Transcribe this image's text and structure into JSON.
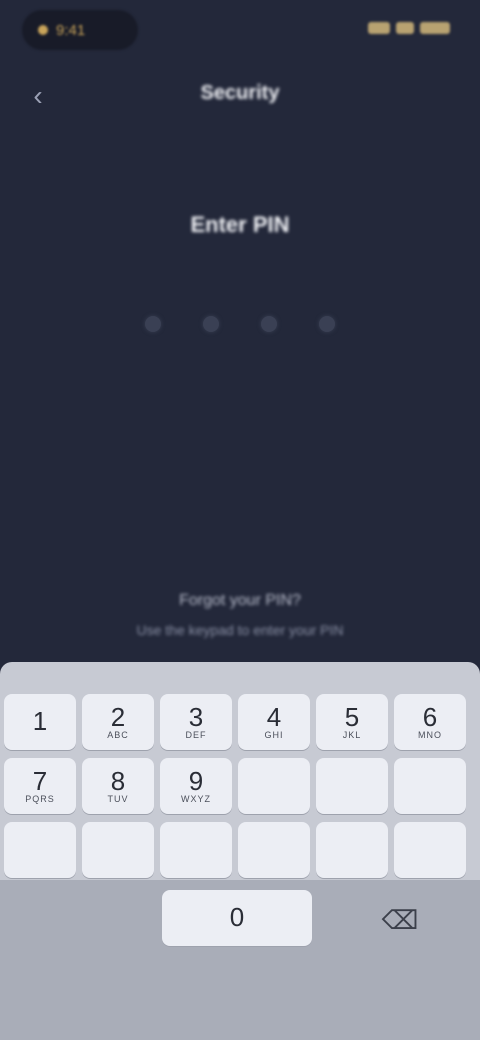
{
  "status_bar": {
    "time": "9:41"
  },
  "header": {
    "back_icon": "chevron-left-icon",
    "title": "Security"
  },
  "main": {
    "prompt": "Enter PIN",
    "pin_length": 4,
    "pin_filled": 0,
    "forgot_link": "Forgot your PIN?",
    "hint": "Use the keypad to enter your PIN"
  },
  "keyboard": {
    "keys": [
      {
        "digit": "1",
        "letters": ""
      },
      {
        "digit": "2",
        "letters": "ABC"
      },
      {
        "digit": "3",
        "letters": "DEF"
      },
      {
        "digit": "4",
        "letters": "GHI"
      },
      {
        "digit": "5",
        "letters": "JKL"
      },
      {
        "digit": "6",
        "letters": "MNO"
      },
      {
        "digit": "7",
        "letters": "PQRS"
      },
      {
        "digit": "8",
        "letters": "TUV"
      },
      {
        "digit": "9",
        "letters": "WXYZ"
      },
      {
        "digit": "0",
        "letters": ""
      }
    ],
    "backspace_icon": "backspace-icon"
  },
  "colors": {
    "background": "#23283a",
    "keyboard": "#c7cad3",
    "key": "#eceef4",
    "accent": "#c9a45a"
  }
}
